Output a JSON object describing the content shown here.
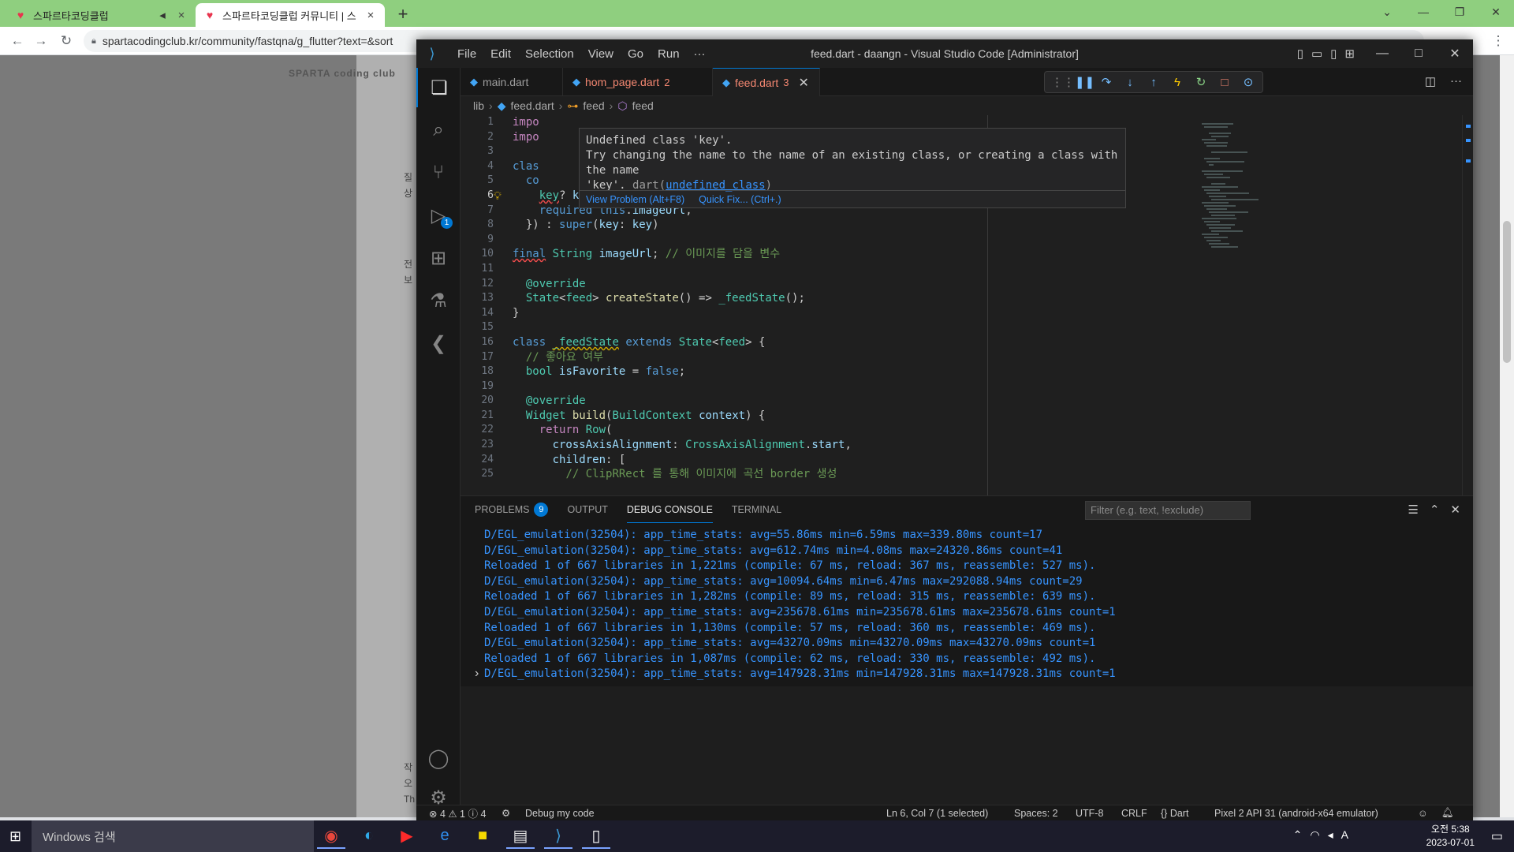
{
  "browser": {
    "tabs": [
      {
        "title": "스파르타코딩클럽",
        "active": false
      },
      {
        "title": "스파르타코딩클럽 커뮤니티 | 스",
        "active": true
      }
    ],
    "url": "spartacodingclub.kr/community/fastqna/g_flutter?text=&sort"
  },
  "webpage": {
    "logo": "SPARTA coding club",
    "side_letters": [
      "질",
      "상",
      "전",
      "보",
      "작",
      "오",
      "Th"
    ]
  },
  "vscode": {
    "menu": [
      "File",
      "Edit",
      "Selection",
      "View",
      "Go",
      "Run",
      "···"
    ],
    "title": "feed.dart - daangn - Visual Studio Code [Administrator]",
    "activity_badge": "1",
    "tabs": [
      {
        "name": "main.dart",
        "num": ""
      },
      {
        "name": "hom_page.dart",
        "num": "2"
      },
      {
        "name": "feed.dart",
        "num": "3"
      }
    ],
    "breadcrumb": [
      "lib",
      "feed.dart",
      "feed",
      "feed"
    ],
    "hover": {
      "line1": "Undefined class 'key'.",
      "line2": "Try changing the name to the name of an existing class, or creating a class with the name",
      "line3_pre": "'key'. ",
      "line3_src": "dart(",
      "line3_link": "undefined_class",
      "line3_end": ")",
      "view_problem": "View Problem (Alt+F8)",
      "quick_fix": "Quick Fix... (Ctrl+.)"
    },
    "line_numbers": [
      "1",
      "2",
      "3",
      "4",
      "5",
      "6",
      "7",
      "8",
      "9",
      "10",
      "11",
      "12",
      "13",
      "14",
      "15",
      "16",
      "17",
      "18",
      "19",
      "20",
      "21",
      "22",
      "23",
      "24",
      "25"
    ],
    "panel": {
      "tabs": [
        {
          "label": "PROBLEMS",
          "badge": "9"
        },
        {
          "label": "OUTPUT",
          "badge": ""
        },
        {
          "label": "DEBUG CONSOLE",
          "badge": ""
        },
        {
          "label": "TERMINAL",
          "badge": ""
        }
      ],
      "filter_placeholder": "Filter (e.g. text, !exclude)",
      "console_lines": [
        "D/EGL_emulation(32504): app_time_stats: avg=55.86ms min=6.59ms max=339.80ms count=17",
        "D/EGL_emulation(32504): app_time_stats: avg=612.74ms min=4.08ms max=24320.86ms count=41",
        "Reloaded 1 of 667 libraries in 1,221ms (compile: 67 ms, reload: 367 ms, reassemble: 527 ms).",
        "D/EGL_emulation(32504): app_time_stats: avg=10094.64ms min=6.47ms max=292088.94ms count=29",
        "Reloaded 1 of 667 libraries in 1,282ms (compile: 89 ms, reload: 315 ms, reassemble: 639 ms).",
        "D/EGL_emulation(32504): app_time_stats: avg=235678.61ms min=235678.61ms max=235678.61ms count=1",
        "Reloaded 1 of 667 libraries in 1,130ms (compile: 57 ms, reload: 360 ms, reassemble: 469 ms).",
        "D/EGL_emulation(32504): app_time_stats: avg=43270.09ms min=43270.09ms max=43270.09ms count=1",
        "Reloaded 1 of 667 libraries in 1,087ms (compile: 62 ms, reload: 330 ms, reassemble: 492 ms).",
        "D/EGL_emulation(32504): app_time_stats: avg=147928.31ms min=147928.31ms max=147928.31ms count=1"
      ]
    },
    "status": {
      "problems": "⊗ 4 ⚠ 1 ⓘ 4",
      "debug": "Debug my code",
      "position": "Ln 6, Col 7 (1 selected)",
      "spaces": "Spaces: 2",
      "encoding": "UTF-8",
      "eol": "CRLF",
      "language": "{} Dart",
      "device": "Pixel 2 API 31 (android-x64 emulator)"
    }
  },
  "taskbar": {
    "search_placeholder": "Windows 검색",
    "time": "오전 5:38",
    "date": "2023-07-01"
  }
}
